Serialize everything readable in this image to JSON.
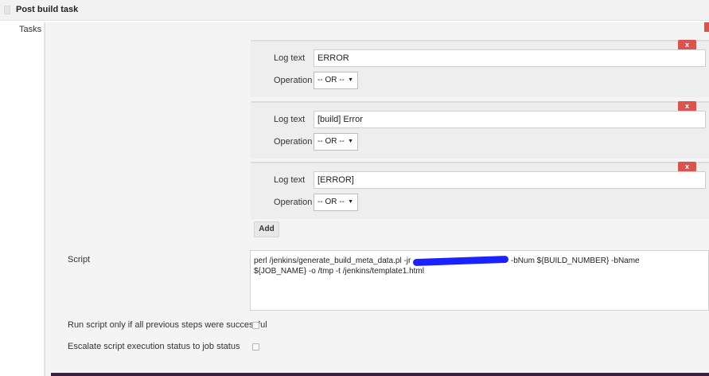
{
  "header": {
    "title": "Post build task"
  },
  "tasks_label": "Tasks",
  "tasks": [
    {
      "log_label": "Log text",
      "log_value": "ERROR",
      "op_label": "Operation",
      "op_value": "-- OR --",
      "delete_label": "x"
    },
    {
      "log_label": "Log text",
      "log_value": "[build] Error",
      "op_label": "Operation",
      "op_value": "-- OR --",
      "delete_label": "x"
    },
    {
      "log_label": "Log text",
      "log_value": "[ERROR]",
      "op_label": "Operation",
      "op_value": "-- OR --",
      "delete_label": "x"
    }
  ],
  "add_label": "Add",
  "script": {
    "label": "Script",
    "line1_start": "perl /jenkins/generate_build_meta_data.pl -jr ",
    "line1_end": " -bNum ${BUILD_NUMBER} -bName",
    "line2": "${JOB_NAME} -o /tmp -t /jenkins/template1.html"
  },
  "options": {
    "run_only_label": "Run script only if all previous steps were successful",
    "escalate_label": "Escalate script execution status to job status"
  },
  "colors": {
    "danger": "#d9534f",
    "redaction": "#1a22ff"
  }
}
